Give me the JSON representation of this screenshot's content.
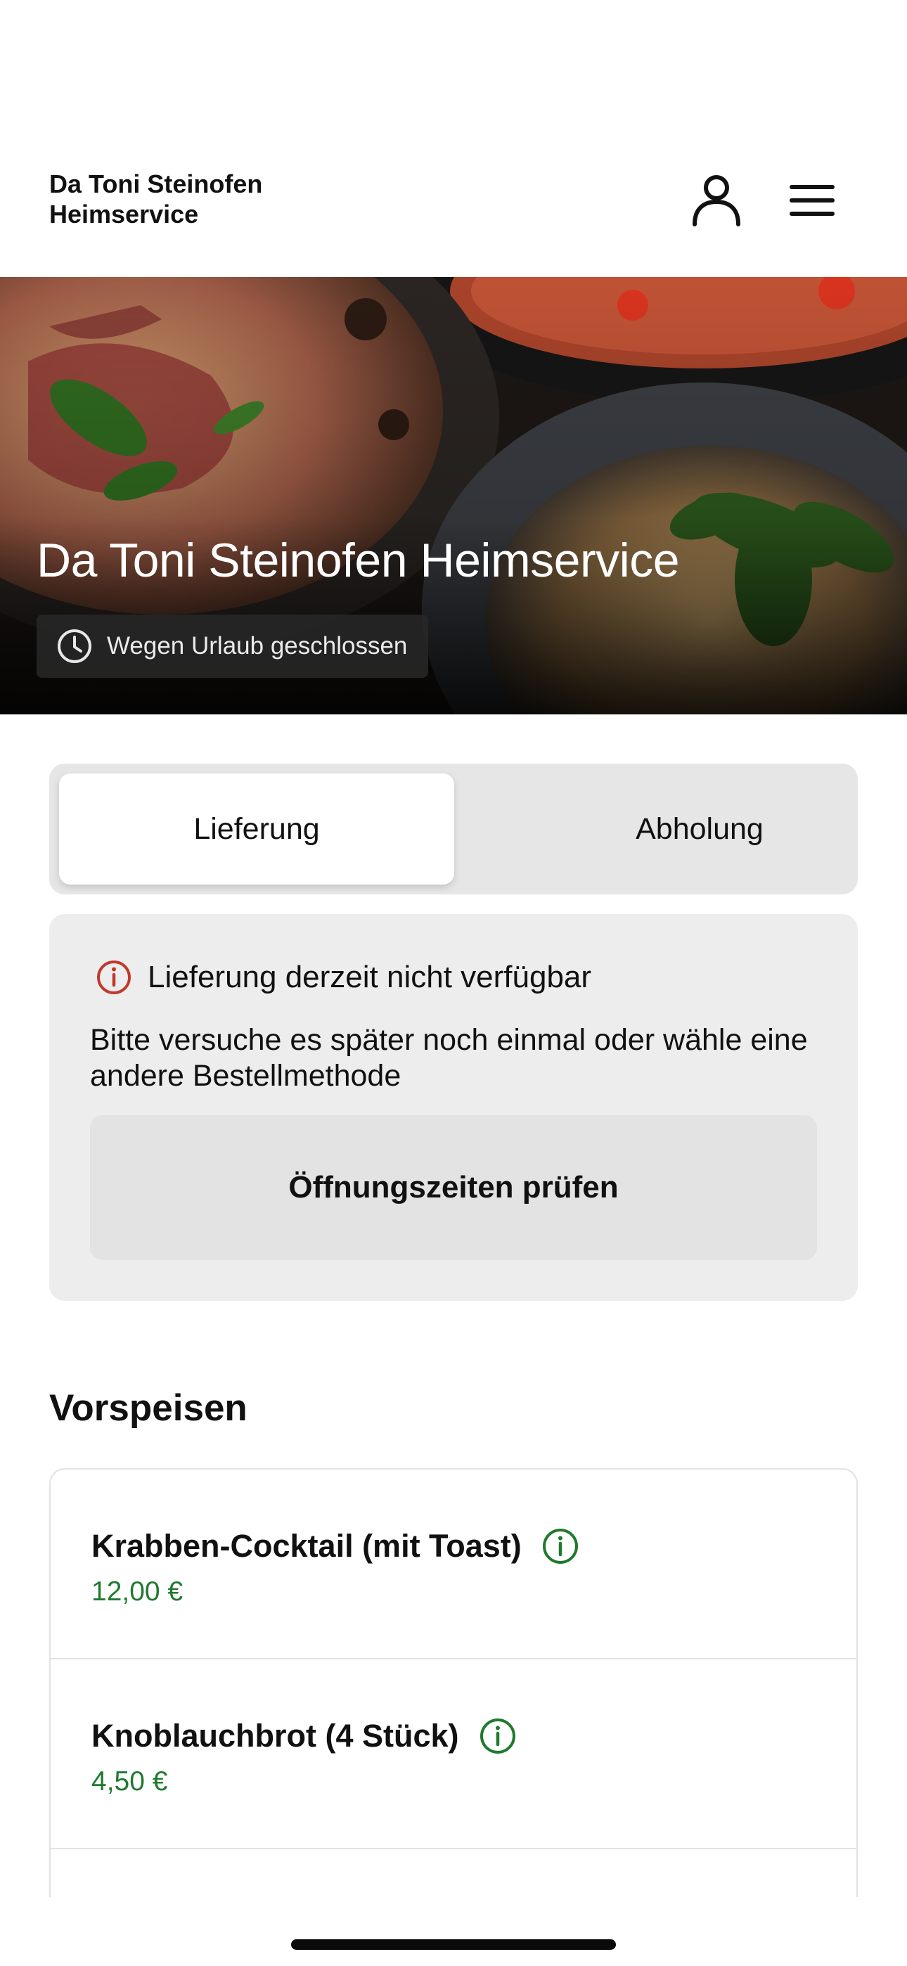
{
  "header": {
    "brand": "Da Toni Steinofen Heimservice",
    "icons": {
      "account": "user-icon",
      "menu": "hamburger-menu-icon"
    }
  },
  "hero": {
    "title": "Da Toni Steinofen Heimservice",
    "status": "Wegen Urlaub geschlossen",
    "status_icon": "clock-icon"
  },
  "order_mode": {
    "options": [
      "Lieferung",
      "Abholung"
    ],
    "selected": "Lieferung"
  },
  "notice": {
    "title": "Lieferung derzeit nicht verfügbar",
    "message": "Bitte versuche es später noch einmal oder wähle eine andere Bestellmethode",
    "button": "Öffnungszeiten prüfen",
    "icon": "info-alert-icon"
  },
  "menu": {
    "section_title": "Vorspeisen",
    "items": [
      {
        "name": "Krabben-Cocktail (mit Toast)",
        "price": "12,00 €"
      },
      {
        "name": "Knoblauchbrot (4 Stück)",
        "price": "4,50 €"
      }
    ]
  },
  "colors": {
    "accent_green": "#1f7a2e",
    "alert_red": "#c0392b",
    "card_bg": "#ededed",
    "segmented_bg": "#e6e6e6"
  }
}
